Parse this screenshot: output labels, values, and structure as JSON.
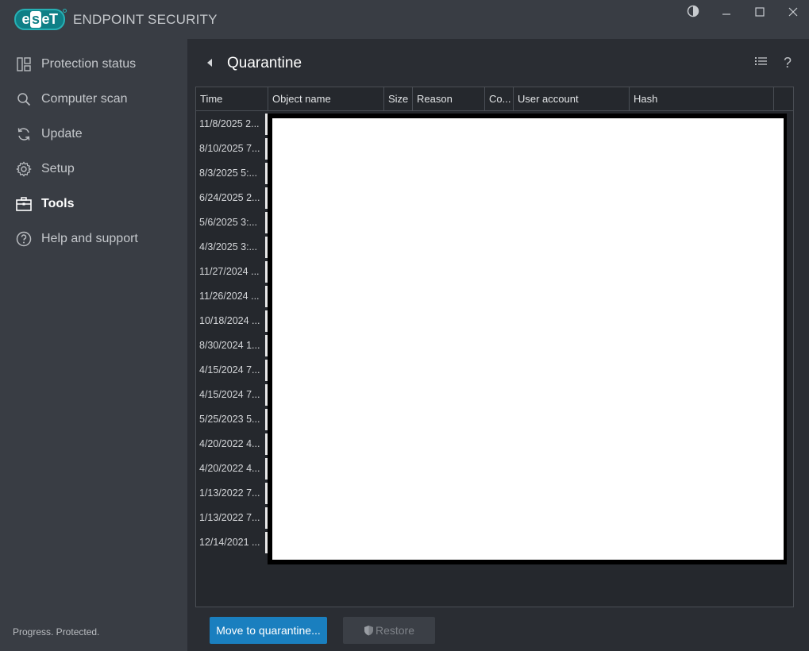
{
  "window": {
    "logo_text": "eset",
    "product": "ENDPOINT SECURITY"
  },
  "sidebar": {
    "items": [
      {
        "label": "Protection status",
        "icon": "dashboard-icon"
      },
      {
        "label": "Computer scan",
        "icon": "search-icon"
      },
      {
        "label": "Update",
        "icon": "refresh-icon"
      },
      {
        "label": "Setup",
        "icon": "gear-icon"
      },
      {
        "label": "Tools",
        "icon": "toolbox-icon",
        "active": true
      },
      {
        "label": "Help and support",
        "icon": "help-icon"
      }
    ],
    "footer": "Progress. Protected."
  },
  "main": {
    "title": "Quarantine",
    "columns": [
      "Time",
      "Object name",
      "Size",
      "Reason",
      "Co...",
      "User account",
      "Hash"
    ],
    "rows": [
      "11/8/2025 2...",
      "8/10/2025 7...",
      "8/3/2025 5:...",
      "6/24/2025 2...",
      "5/6/2025 3:...",
      "4/3/2025 3:...",
      "11/27/2024 ...",
      "11/26/2024 ...",
      "10/18/2024 ...",
      "8/30/2024 1...",
      "4/15/2024 7...",
      "4/15/2024 7...",
      "5/25/2023 5...",
      "4/20/2022 4...",
      "4/20/2022 4...",
      "1/13/2022 7...",
      "1/13/2022 7...",
      "12/14/2021 ..."
    ],
    "buttons": {
      "move": "Move to quarantine...",
      "restore": "Restore"
    }
  }
}
